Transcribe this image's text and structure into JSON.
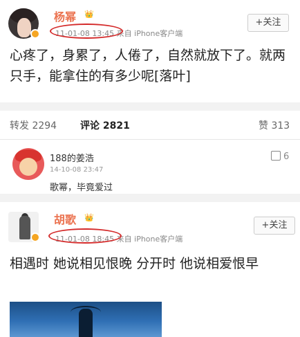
{
  "post1": {
    "author": "杨幂",
    "crown_icon": "crown-icon",
    "time": "11-01-08 13:45",
    "source": "来自 iPhone客户端",
    "follow_label": "+关注",
    "text": "心疼了，身累了，人倦了，自然就放下了。就两只手，能拿住的有多少呢[落叶]"
  },
  "actions": {
    "repost": "转发 2294",
    "comment": "评论 2821",
    "like": "赞 313"
  },
  "comment": {
    "name": "188的姜浩",
    "date": "14-10-08 23:47",
    "text": "歌幂，毕竟爱过",
    "likes": "6",
    "like_icon": "thumbs-up-icon"
  },
  "post2": {
    "author": "胡歌",
    "crown_icon": "crown-icon",
    "time": "11-01-08 18:45",
    "source": "来自 iPhone客户端",
    "follow_label": "+关注",
    "text": "相遇时 她说相见恨晚 分开时 他说相爱恨早"
  },
  "colors": {
    "author": "#eb7350",
    "highlight_ring": "#d42a2a",
    "badge": "#f5a623"
  }
}
